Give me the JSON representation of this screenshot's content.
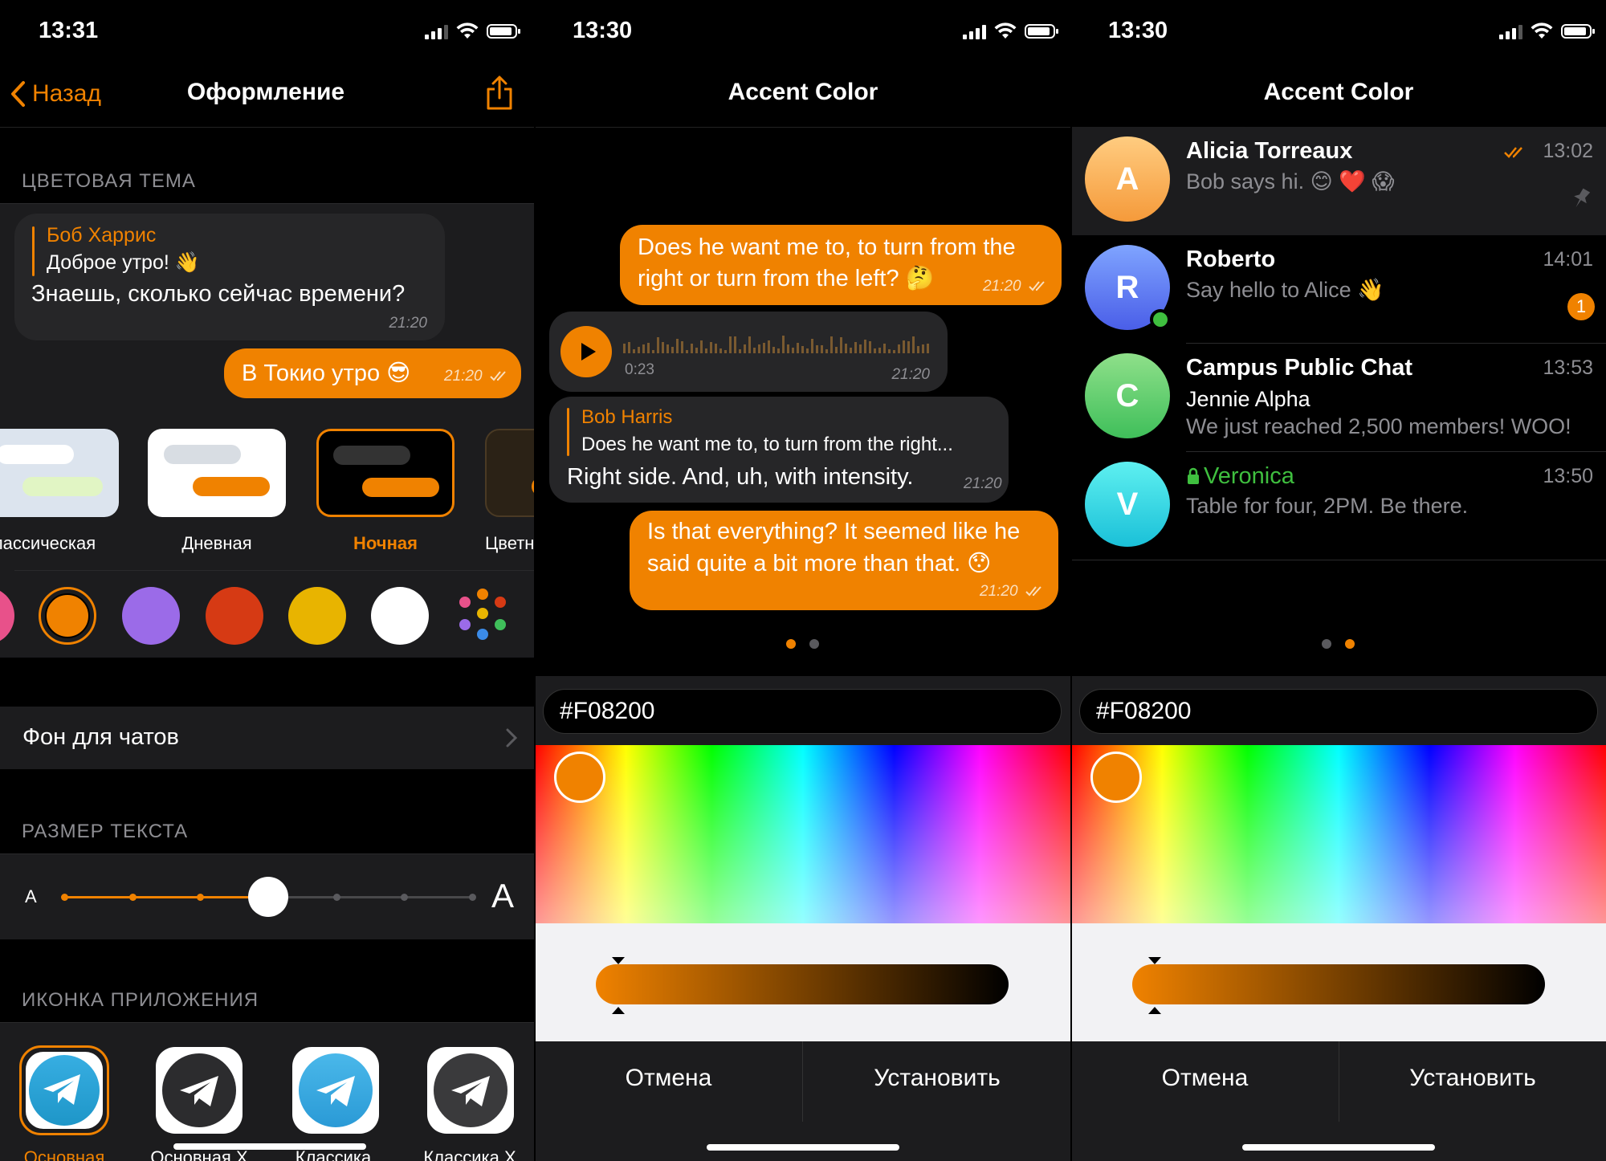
{
  "colors": {
    "accent": "#f08200",
    "bubble_in": "#262628",
    "group_bg": "#1c1c1e",
    "secondary_text": "#8e8e93"
  },
  "left": {
    "status_time": "13:31",
    "back_label": "Назад",
    "title": "Оформление",
    "theme_section": "ЦВЕТОВАЯ ТЕМА",
    "preview": {
      "reply_name": "Боб Харрис",
      "reply_text": "Доброе утро! 👋",
      "incoming_text": "Знаешь, сколько сейчас времени?",
      "incoming_time": "21:20",
      "outgoing_text": "В Токио утро 😎",
      "outgoing_time": "21:20"
    },
    "themes": [
      {
        "label": "лассическая"
      },
      {
        "label": "Дневная"
      },
      {
        "label": "Ночная",
        "selected": true
      },
      {
        "label": "Цветн"
      }
    ],
    "color_swatches": [
      "#e8518a",
      "#f08200",
      "#9b6be8",
      "#d63a14",
      "#e8b400",
      "#ffffff",
      "multicolor"
    ],
    "chat_bg_label": "Фон для чатов",
    "text_size_section": "РАЗМЕР ТЕКСТА",
    "text_size_small": "A",
    "text_size_large": "A",
    "text_size_level": 0.5,
    "app_icon_section": "ИКОНКА ПРИЛОЖЕНИЯ",
    "app_icons": [
      {
        "label": "Основная",
        "selected": true
      },
      {
        "label": "Основная Х"
      },
      {
        "label": "Классика"
      },
      {
        "label": "Классика Х"
      }
    ]
  },
  "middle": {
    "status_time": "13:30",
    "title": "Accent Color",
    "messages": {
      "out1_line1": "Does he want me to, to turn from the",
      "out1_line2": "right or turn from the left? 🤔",
      "out1_time": "21:20",
      "voice_duration": "0:23",
      "voice_time": "21:20",
      "reply_name": "Bob Harris",
      "reply_text": "Does he want me to, to turn from the right...",
      "in_text": "Right side. And, uh, with intensity.",
      "in_time": "21:20",
      "out2_line1": "Is that everything? It seemed like he",
      "out2_line2": "said quite a bit more than that. 😯",
      "out2_time": "21:20"
    },
    "page_index": 0,
    "hex_value": "#F08200",
    "cancel_label": "Отмена",
    "set_label": "Установить"
  },
  "right": {
    "status_time": "13:30",
    "title": "Accent Color",
    "chats": [
      {
        "initial": "A",
        "name": "Alicia Torreaux",
        "message": "Bob says hi. 😊 ❤️ 😱",
        "time": "13:02",
        "avatar_colors": [
          "#ffcc80",
          "#f59a3a"
        ]
      },
      {
        "initial": "R",
        "name": "Roberto",
        "message": "Say hello to Alice 👋",
        "time": "14:01",
        "badge": "1",
        "avatar_colors": [
          "#7fa4ff",
          "#4a5ee8"
        ]
      },
      {
        "initial": "C",
        "name": "Campus Public Chat",
        "sender": "Jennie Alpha",
        "message": "We just reached 2,500 members! WOO!",
        "time": "13:53",
        "avatar_colors": [
          "#8fe08a",
          "#3fbf5a"
        ]
      },
      {
        "initial": "V",
        "name": "Veronica",
        "message": "Table for four, 2PM. Be there.",
        "time": "13:50",
        "avatar_colors": [
          "#5ef0f0",
          "#1ac0d8"
        ]
      }
    ],
    "page_index": 1,
    "hex_value": "#F08200",
    "cancel_label": "Отмена",
    "set_label": "Установить"
  }
}
